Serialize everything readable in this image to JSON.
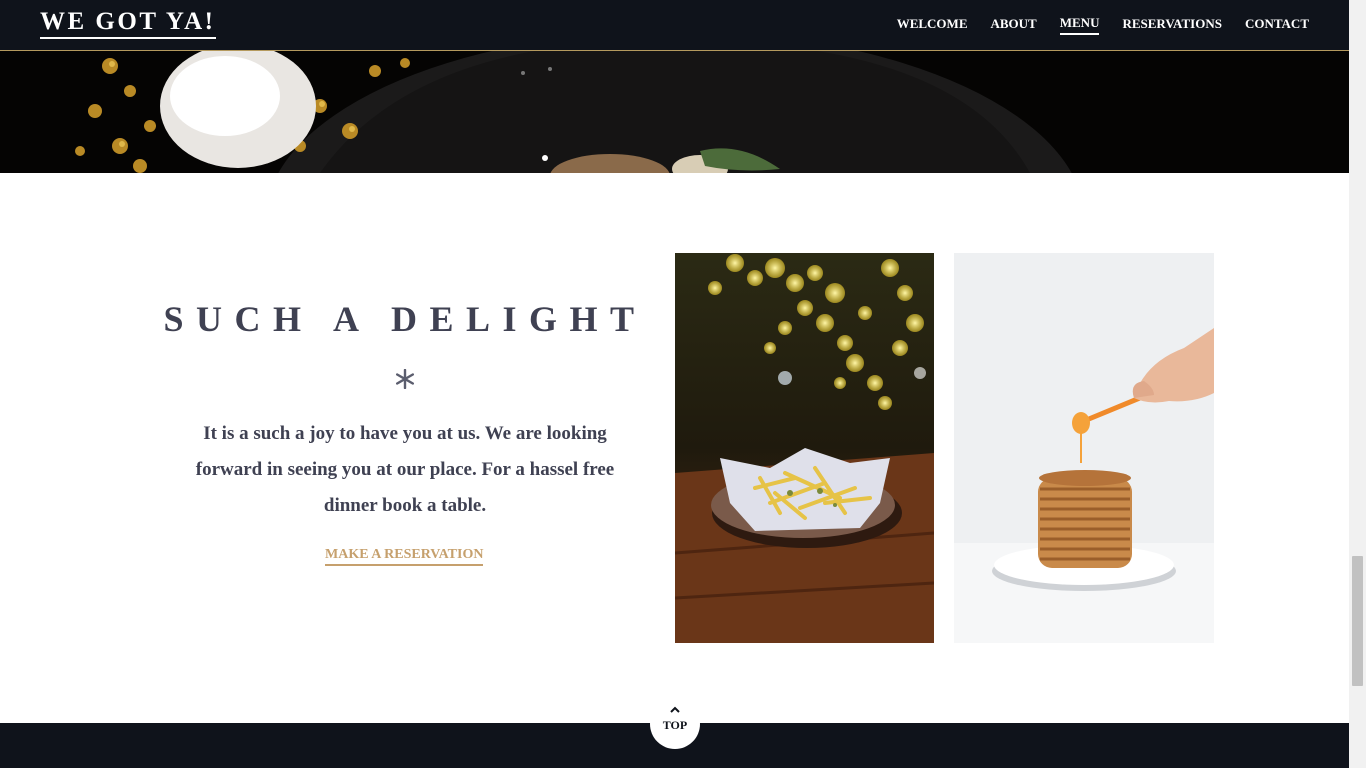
{
  "header": {
    "logo": "WE GOT YA!",
    "nav": [
      "WELCOME",
      "ABOUT",
      "MENU",
      "RESERVATIONS",
      "CONTACT"
    ],
    "active_nav": "MENU"
  },
  "section": {
    "title": "SUCH A DELIGHT",
    "divider_icon": "asterisk-icon",
    "text": "It is a such a joy to have you at us. We are looking forward in seeing you at our place. For a hassel free dinner book a table.",
    "cta": "MAKE A RESERVATION"
  },
  "photos": [
    "fries-photo",
    "pancakes-photo"
  ],
  "back_to_top": {
    "label": "TOP",
    "icon": "chevron-up-icon"
  },
  "colors": {
    "header_bg": "#0f131b",
    "accent_gold": "#c6a06d",
    "text_dark": "#3f4152"
  }
}
